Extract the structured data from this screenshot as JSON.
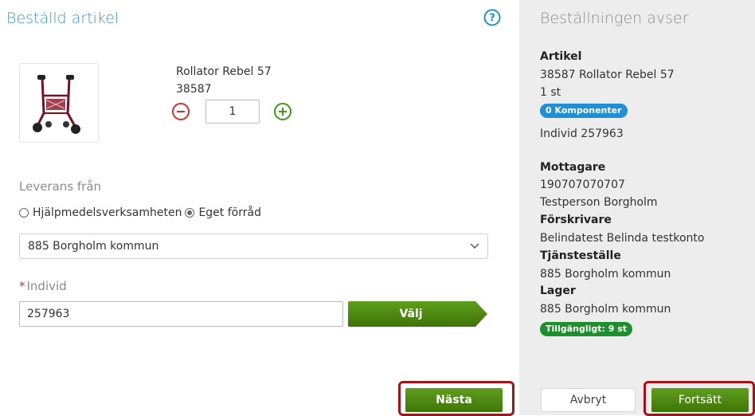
{
  "left": {
    "title": "Beställd artikel",
    "help_icon": "question-circle-icon",
    "product": {
      "image_icon": "rollator-image",
      "name": "Rollator Rebel 57",
      "number": "38587",
      "quantity": "1"
    },
    "delivery": {
      "label": "Leverans från",
      "option_1": "Hjälpmedelsverksamheten",
      "option_2": "Eget förråd",
      "selected_option": "Eget förråd",
      "select_value": "885 Borgholm kommun"
    },
    "individ": {
      "required_mark": "*",
      "label": "Individ",
      "value": "257963",
      "button_label": "Välj"
    },
    "next_button": "Nästa"
  },
  "right": {
    "title": "Beställningen avser",
    "artikel_heading": "Artikel",
    "artikel_line": "38587 Rollator Rebel 57",
    "artikel_qty": "1 st",
    "components_badge": "0 Komponenter",
    "individ_line": "Individ 257963",
    "mottagare_heading": "Mottagare",
    "mottagare_id": "190707070707",
    "mottagare_name": "Testperson Borgholm",
    "forskrivare_heading": "Förskrivare",
    "forskrivare_name": "Belindatest Belinda testkonto",
    "tjanstestalle_heading": "Tjänsteställe",
    "tjanstestalle_value": "885 Borgholm kommun",
    "lager_heading": "Lager",
    "lager_value": "885 Borgholm kommun",
    "available_badge": "Tillgängligt: 9 st",
    "cancel_button": "Avbryt",
    "continue_button": "Fortsätt"
  },
  "colors": {
    "accent_blue": "#3a95c9",
    "button_green": "#4f8a10",
    "badge_blue": "#1f8fd8",
    "badge_green": "#1e8f2d",
    "highlight_red": "#a21418",
    "minus_red": "#d0312d",
    "plus_green": "#3c9a14"
  }
}
